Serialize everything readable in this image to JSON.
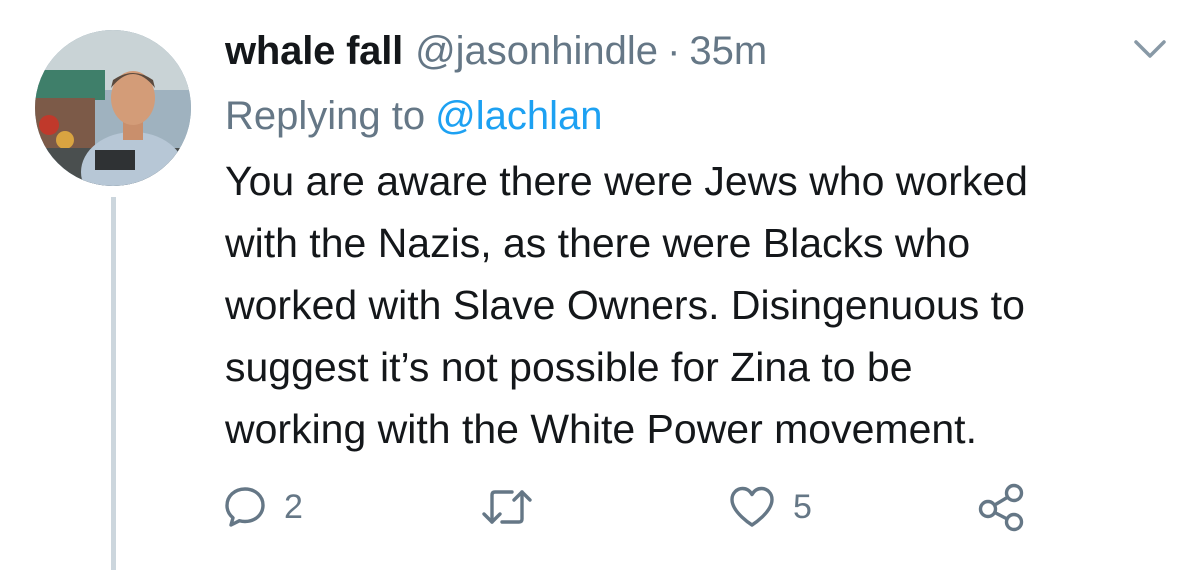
{
  "tweet": {
    "author": {
      "display_name": "whale fall",
      "handle": "@jasonhindle",
      "separator": "·",
      "time": "35m"
    },
    "reply_context": {
      "prefix": "Replying to",
      "mention": "@lachlan"
    },
    "text_lines": [
      "You are aware there were Jews who worked",
      "with the Nazis, as there were Blacks who",
      "worked with Slave Owners. Disingenuous to",
      "suggest it’s not possible for Zina to be",
      "working with the White Power movement."
    ],
    "actions": {
      "reply_count": "2",
      "retweet_count": "",
      "like_count": "5"
    }
  },
  "icons": {
    "menu": "chevron-down-icon",
    "reply": "reply-bubble-icon",
    "retweet": "retweet-icon",
    "like": "heart-icon",
    "share": "share-icon"
  },
  "colors": {
    "text_primary": "#14171a",
    "text_secondary": "#657786",
    "link": "#1da1f2",
    "thread_line": "#ccd6dd",
    "icon": "#657786"
  }
}
